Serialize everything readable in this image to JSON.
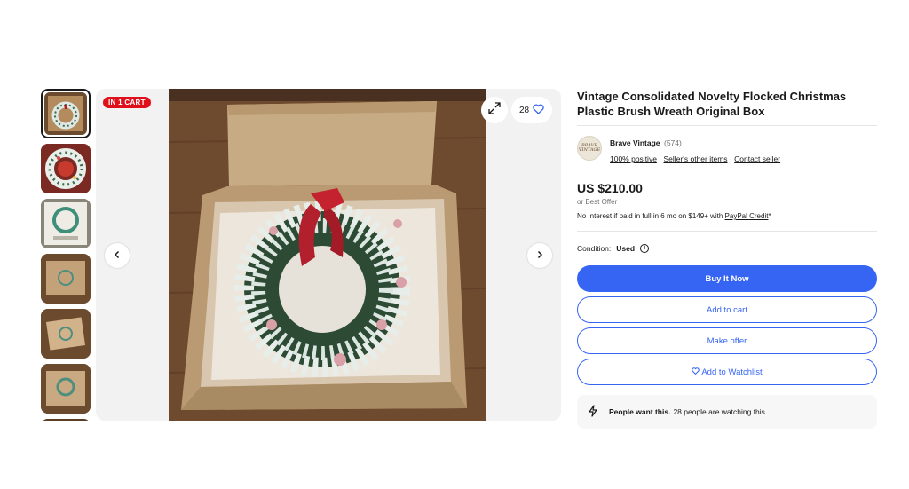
{
  "gallery": {
    "cart_badge": "IN 1 CART",
    "watch_count": "28",
    "thumbnail_count": 7
  },
  "listing": {
    "title": "Vintage Consolidated Novelty Flocked Christmas Plastic Brush Wreath Original Box",
    "seller": {
      "name": "Brave Vintage",
      "feedback_count": "(574)",
      "logo_text": "BRAVE VINTAGE",
      "positive": "100% positive",
      "other_items": "Seller's other items",
      "contact": "Contact seller"
    },
    "price": "US $210.00",
    "best_offer": "or Best Offer",
    "financing_text": "No Interest if paid in full in 6 mo on $149+ with ",
    "financing_link": "PayPal Credit",
    "financing_suffix": "*",
    "condition_label": "Condition:",
    "condition_value": "Used",
    "buy_now": "Buy It Now",
    "add_to_cart": "Add to cart",
    "make_offer": "Make offer",
    "add_to_watchlist": "Add to Watchlist",
    "people_bold": "People want this.",
    "people_text": "28 people are watching this."
  },
  "colors": {
    "accent": "#3665f3",
    "badge": "#e0101b"
  }
}
